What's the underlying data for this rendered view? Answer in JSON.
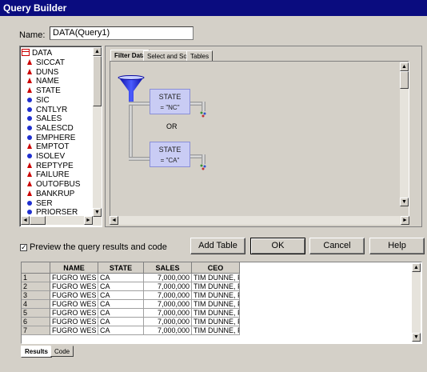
{
  "window": {
    "title": "Query Builder"
  },
  "name_field": {
    "label": "Name:",
    "value": "DATA(Query1)"
  },
  "tree": {
    "root": "DATA",
    "items": [
      {
        "label": "SICCAT",
        "type": "char"
      },
      {
        "label": "DUNS",
        "type": "char"
      },
      {
        "label": "NAME",
        "type": "char"
      },
      {
        "label": "STATE",
        "type": "char"
      },
      {
        "label": "SIC",
        "type": "num"
      },
      {
        "label": "CNTLYR",
        "type": "num"
      },
      {
        "label": "SALES",
        "type": "num"
      },
      {
        "label": "SALESCD",
        "type": "num"
      },
      {
        "label": "EMPHERE",
        "type": "num"
      },
      {
        "label": "EMPTOT",
        "type": "char"
      },
      {
        "label": "ISOLEV",
        "type": "num"
      },
      {
        "label": "REPTYPE",
        "type": "char"
      },
      {
        "label": "FAILURE",
        "type": "char"
      },
      {
        "label": "OUTOFBUS",
        "type": "char"
      },
      {
        "label": "BANKRUP",
        "type": "char"
      },
      {
        "label": "SER",
        "type": "num"
      },
      {
        "label": "PRIORSER",
        "type": "num"
      }
    ]
  },
  "tabs": [
    {
      "label": "Filter Data",
      "active": true
    },
    {
      "label": "Select and Sort",
      "active": false
    },
    {
      "label": "Tables",
      "active": false
    }
  ],
  "filter": {
    "condition1": {
      "field": "STATE",
      "value": "= \"NC\""
    },
    "operator": "OR",
    "condition2": {
      "field": "STATE",
      "value": "= \"CA\""
    }
  },
  "preview_checkbox": {
    "label": "Preview the query results and code",
    "checked": true,
    "mark": "✓"
  },
  "buttons": {
    "add_table": "Add Table",
    "ok": "OK",
    "cancel": "Cancel",
    "help": "Help"
  },
  "results": {
    "columns": [
      "NAME",
      "STATE",
      "SALES",
      "CEO"
    ],
    "rows": [
      {
        "num": "1",
        "cells": [
          "FUGRO WES",
          "CA",
          "7,000,000",
          "TIM DUNNE, P"
        ]
      },
      {
        "num": "2",
        "cells": [
          "FUGRO WES",
          "CA",
          "7,000,000",
          "TIM DUNNE, P"
        ]
      },
      {
        "num": "3",
        "cells": [
          "FUGRO WES",
          "CA",
          "7,000,000",
          "TIM DUNNE, P"
        ]
      },
      {
        "num": "4",
        "cells": [
          "FUGRO WES",
          "CA",
          "7,000,000",
          "TIM DUNNE, P"
        ]
      },
      {
        "num": "5",
        "cells": [
          "FUGRO WES",
          "CA",
          "7,000,000",
          "TIM DUNNE, P"
        ]
      },
      {
        "num": "6",
        "cells": [
          "FUGRO WES",
          "CA",
          "7,000,000",
          "TIM DUNNE, P"
        ]
      },
      {
        "num": "7",
        "cells": [
          "FUGRO WES",
          "CA",
          "7,000,000",
          "TIM DUNNE, P"
        ]
      }
    ]
  },
  "bottom_tabs": [
    {
      "label": "Results",
      "active": true
    },
    {
      "label": "Code",
      "active": false
    }
  ],
  "icons": {
    "char_field": "red-triangle-icon",
    "num_field": "blue-circle-icon",
    "filter": "funnel-icon",
    "output": "tap-icon",
    "table": "table-icon"
  },
  "colors": {
    "titlebar": "#0a0c7f",
    "condition_box": "#c9ccf4",
    "funnel": "#1a1ad0"
  },
  "scroll_glyphs": {
    "up": "▲",
    "down": "▼",
    "left": "◄",
    "right": "►"
  }
}
